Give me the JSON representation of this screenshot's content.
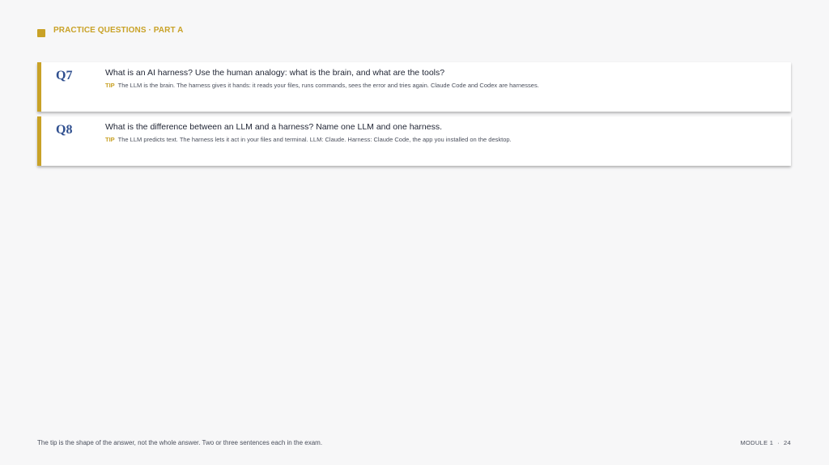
{
  "header": {
    "label": "PRACTICE QUESTIONS · PART A"
  },
  "colors": {
    "accent_gold": "#c9a227",
    "question_number_blue": "#2f4f8f"
  },
  "questions": [
    {
      "number": "Q7",
      "text": "What is an AI harness? Use the human analogy: what is the brain, and what are the tools?",
      "tip_label": "TIP",
      "tip": "The LLM is the brain. The harness gives it hands: it reads your files, runs commands, sees the error and tries again. Claude Code and Codex are harnesses."
    },
    {
      "number": "Q8",
      "text": "What is the difference between an LLM and a harness? Name one LLM and one harness.",
      "tip_label": "TIP",
      "tip": "The LLM predicts text. The harness lets it act in your files and terminal. LLM: Claude. Harness: Claude Code, the app you installed on the desktop."
    }
  ],
  "footer": {
    "note": "The tip is the shape of the answer, not the whole answer. Two or three sentences each in the exam.",
    "module": "MODULE 1",
    "separator": "·",
    "page": "24"
  }
}
